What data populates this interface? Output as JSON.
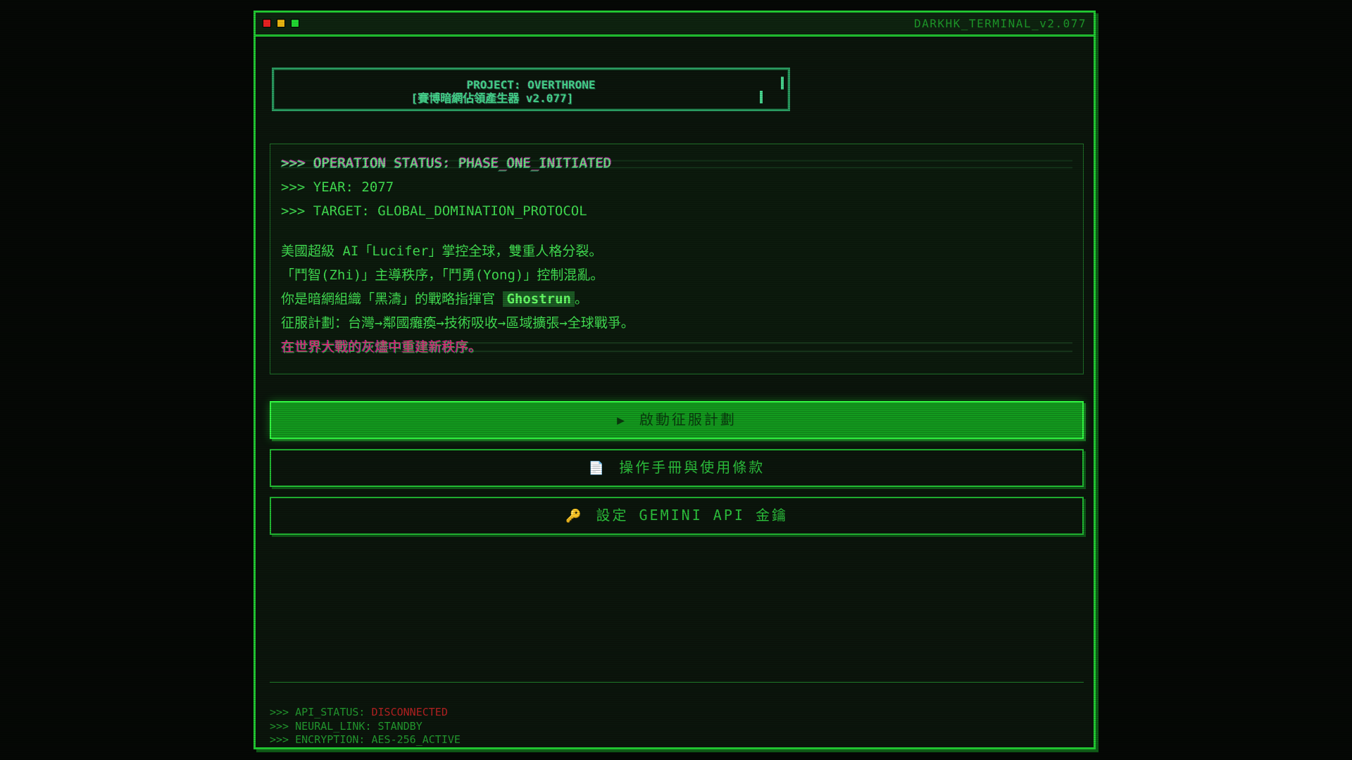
{
  "window": {
    "title": "DARKHK_TERMINAL_v2.077"
  },
  "logo": {
    "line1": "PROJECT: OVERTHRONE",
    "line2": "[賽博暗網佔領產生器 v2.077]"
  },
  "terminal": {
    "status_line": ">>> OPERATION STATUS: PHASE_ONE_INITIATED",
    "year_line": ">>> YEAR: 2077",
    "target_line": ">>> TARGET: GLOBAL_DOMINATION_PROTOCOL",
    "story_1": "美國超級 AI「Lucifer」掌控全球，雙重人格分裂。",
    "story_2": "「鬥智(Zhi)」主導秩序，「鬥勇(Yong)」控制混亂。",
    "story_3_prefix": "你是暗網組織「黑濤」的戰略指揮官 ",
    "story_3_name": "Ghostrun",
    "story_3_suffix": "。",
    "story_4": "征服計劃：台灣→鄰國癱瘓→技術吸收→區域擴張→全球戰爭。",
    "story_5": "在世界大戰的灰燼中重建新秩序。"
  },
  "buttons": {
    "start_icon": "▶",
    "start_label": "啟動征服計劃",
    "manual_icon": "📄",
    "manual_label": "操作手冊與使用條款",
    "api_icon": "🔑",
    "api_label": "設定 GEMINI API 金鑰"
  },
  "status": {
    "api_prefix": ">>> API_STATUS: ",
    "api_value": "DISCONNECTED",
    "neural": ">>> NEURAL_LINK: STANDBY",
    "encryption": ">>> ENCRYPTION: AES-256_ACTIVE"
  },
  "colors": {
    "accent": "#33dd44",
    "error": "#b82222",
    "glitch_magenta": "#ee2277"
  }
}
